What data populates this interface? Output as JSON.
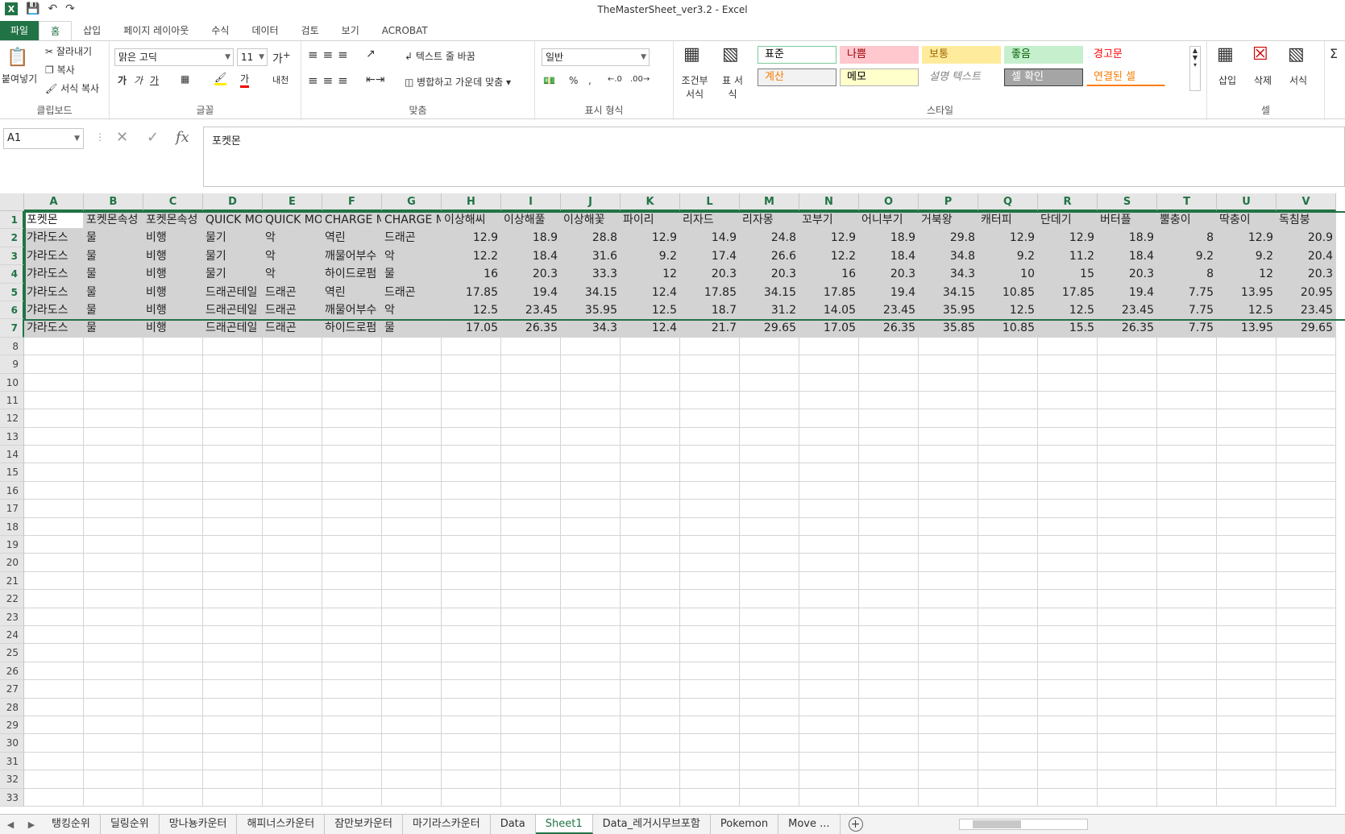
{
  "window": {
    "title": "TheMasterSheet_ver3.2 - Excel"
  },
  "qat": {
    "app_icon": "X",
    "save_icon": "save-icon",
    "undo_icon": "undo-icon",
    "redo_icon": "redo-icon"
  },
  "tabs": [
    "파일",
    "홈",
    "삽입",
    "페이지 레이아웃",
    "수식",
    "데이터",
    "검토",
    "보기",
    "ACROBAT"
  ],
  "ribbon": {
    "clipboard": {
      "paste": "붙여넣기",
      "cut": "잘라내기",
      "copy": "복사",
      "format_painter": "서식 복사",
      "label": "클립보드"
    },
    "font": {
      "name": "맑은 고딕",
      "size": "11",
      "bold": "가",
      "italic": "가",
      "underline": "가",
      "label": "글꼴",
      "fontcolor": "가",
      "phonetic": "내천"
    },
    "align": {
      "wrap": "텍스트 줄 바꿈",
      "merge": "병합하고 가운데 맞춤",
      "label": "맞춤"
    },
    "number": {
      "format": "일반",
      "percent": "%",
      "comma": ",",
      "label": "표시 형식"
    },
    "styles": {
      "cond": "조건부 서식",
      "table": "표 서식",
      "cells": [
        "표준",
        "나쁨",
        "보통",
        "좋음",
        "경고문",
        "계산",
        "메모",
        "설명 텍스트",
        "셀 확인",
        "연결된 셀"
      ],
      "label": "스타일"
    },
    "cells": {
      "insert": "삽입",
      "delete": "삭제",
      "format": "서식",
      "label": "셀"
    }
  },
  "formula_bar": {
    "name_box": "A1",
    "formula": "포켓몬",
    "fx": "fx"
  },
  "columns": [
    "A",
    "B",
    "C",
    "D",
    "E",
    "F",
    "G",
    "H",
    "I",
    "J",
    "K",
    "L",
    "M",
    "N",
    "O",
    "P",
    "Q",
    "R",
    "S",
    "T",
    "U",
    "V"
  ],
  "rows": [
    [
      "포켓몬",
      "포켓몬속성",
      "포켓몬속성",
      "QUICK MO",
      "QUICK MO",
      "CHARGE M",
      "CHARGE M",
      "이상해씨",
      "이상해풀",
      "이상해꽃",
      "파이리",
      "리자드",
      "리자몽",
      "꼬부기",
      "어니부기",
      "거북왕",
      "캐터피",
      "단데기",
      "버터플",
      "뿔충이",
      "딱충이",
      "독침붕"
    ],
    [
      "갸라도스",
      "물",
      "비행",
      "물기",
      "악",
      "역린",
      "드래곤",
      "12.9",
      "18.9",
      "28.8",
      "12.9",
      "14.9",
      "24.8",
      "12.9",
      "18.9",
      "29.8",
      "12.9",
      "12.9",
      "18.9",
      "8",
      "12.9",
      "20.9"
    ],
    [
      "갸라도스",
      "물",
      "비행",
      "물기",
      "악",
      "깨물어부수",
      "악",
      "12.2",
      "18.4",
      "31.6",
      "9.2",
      "17.4",
      "26.6",
      "12.2",
      "18.4",
      "34.8",
      "9.2",
      "11.2",
      "18.4",
      "9.2",
      "9.2",
      "20.4"
    ],
    [
      "갸라도스",
      "물",
      "비행",
      "물기",
      "악",
      "하이드로펌",
      "물",
      "16",
      "20.3",
      "33.3",
      "12",
      "20.3",
      "20.3",
      "16",
      "20.3",
      "34.3",
      "10",
      "15",
      "20.3",
      "8",
      "12",
      "20.3"
    ],
    [
      "갸라도스",
      "물",
      "비행",
      "드래곤테일",
      "드래곤",
      "역린",
      "드래곤",
      "17.85",
      "19.4",
      "34.15",
      "12.4",
      "17.85",
      "34.15",
      "17.85",
      "19.4",
      "34.15",
      "10.85",
      "17.85",
      "19.4",
      "7.75",
      "13.95",
      "20.95"
    ],
    [
      "갸라도스",
      "물",
      "비행",
      "드래곤테일",
      "드래곤",
      "깨물어부수",
      "악",
      "12.5",
      "23.45",
      "35.95",
      "12.5",
      "18.7",
      "31.2",
      "14.05",
      "23.45",
      "35.95",
      "12.5",
      "12.5",
      "23.45",
      "7.75",
      "12.5",
      "23.45"
    ],
    [
      "갸라도스",
      "물",
      "비행",
      "드래곤테일",
      "드래곤",
      "하이드로펌",
      "물",
      "17.05",
      "26.35",
      "34.3",
      "12.4",
      "21.7",
      "29.65",
      "17.05",
      "26.35",
      "35.85",
      "10.85",
      "15.5",
      "26.35",
      "7.75",
      "13.95",
      "29.65"
    ]
  ],
  "row_count": 33,
  "sheets": [
    "탱킹순위",
    "딜링순위",
    "망나뇽카운터",
    "해피너스카운터",
    "잠만보카운터",
    "마기라스카운터",
    "Data",
    "Sheet1",
    "Data_레거시무브포함",
    "Pokemon",
    "Move ..."
  ],
  "active_sheet": "Sheet1"
}
